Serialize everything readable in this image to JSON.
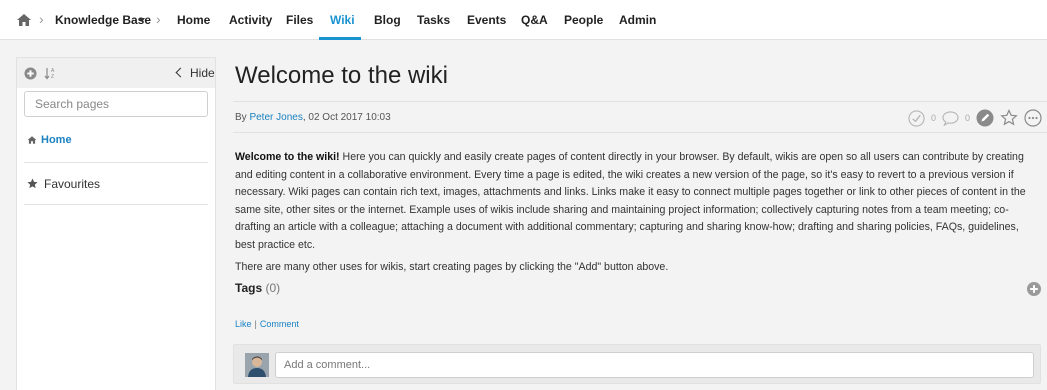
{
  "topnav": {
    "breadcrumb": "Knowledge Base",
    "items": [
      {
        "label": "Home"
      },
      {
        "label": "Activity"
      },
      {
        "label": "Files"
      },
      {
        "label": "Wiki"
      },
      {
        "label": "Blog"
      },
      {
        "label": "Tasks"
      },
      {
        "label": "Events"
      },
      {
        "label": "Q&A"
      },
      {
        "label": "People"
      },
      {
        "label": "Admin"
      }
    ],
    "active_item": "Wiki"
  },
  "sidebar": {
    "hide_label": "Hide",
    "search_placeholder": "Search pages",
    "home_label": "Home",
    "favourites_label": "Favourites"
  },
  "page": {
    "title": "Welcome to the wiki",
    "byline_prefix": "By",
    "author": "Peter Jones",
    "date": ", 02 Oct 2017 10:03",
    "check_count": "0",
    "comment_count": "0",
    "intro_bold": "Welcome to the wiki!",
    "paragraph1": " Here you can quickly and easily create pages of content directly in your browser. By default, wikis are open so all users can contribute by creating and editing content in a collaborative environment. Every time a page is edited, the wiki creates a new version of the page, so it's easy to revert to a previous version if necessary. Wiki pages can contain rich text, images, attachments and links. Links make it easy to connect multiple pages together or link to other pieces of content in the same site, other sites or the internet. Example uses of wikis include sharing and maintaining project information; collectively capturing notes from a team meeting; co-drafting an article with a colleague; attaching a document with additional commentary; capturing and sharing know-how; drafting and sharing policies, FAQs, guidelines, best practice etc.",
    "paragraph2": "There are many other uses for wikis, start creating pages by clicking the \"Add\" button above.",
    "tags_label": "Tags",
    "tags_count": "(0)",
    "like_label": "Like",
    "comment_label": "Comment",
    "comment_placeholder": "Add a comment..."
  },
  "colors": {
    "accent": "#1a93d1",
    "link": "#1a82c2",
    "background": "#f3f3f3"
  }
}
